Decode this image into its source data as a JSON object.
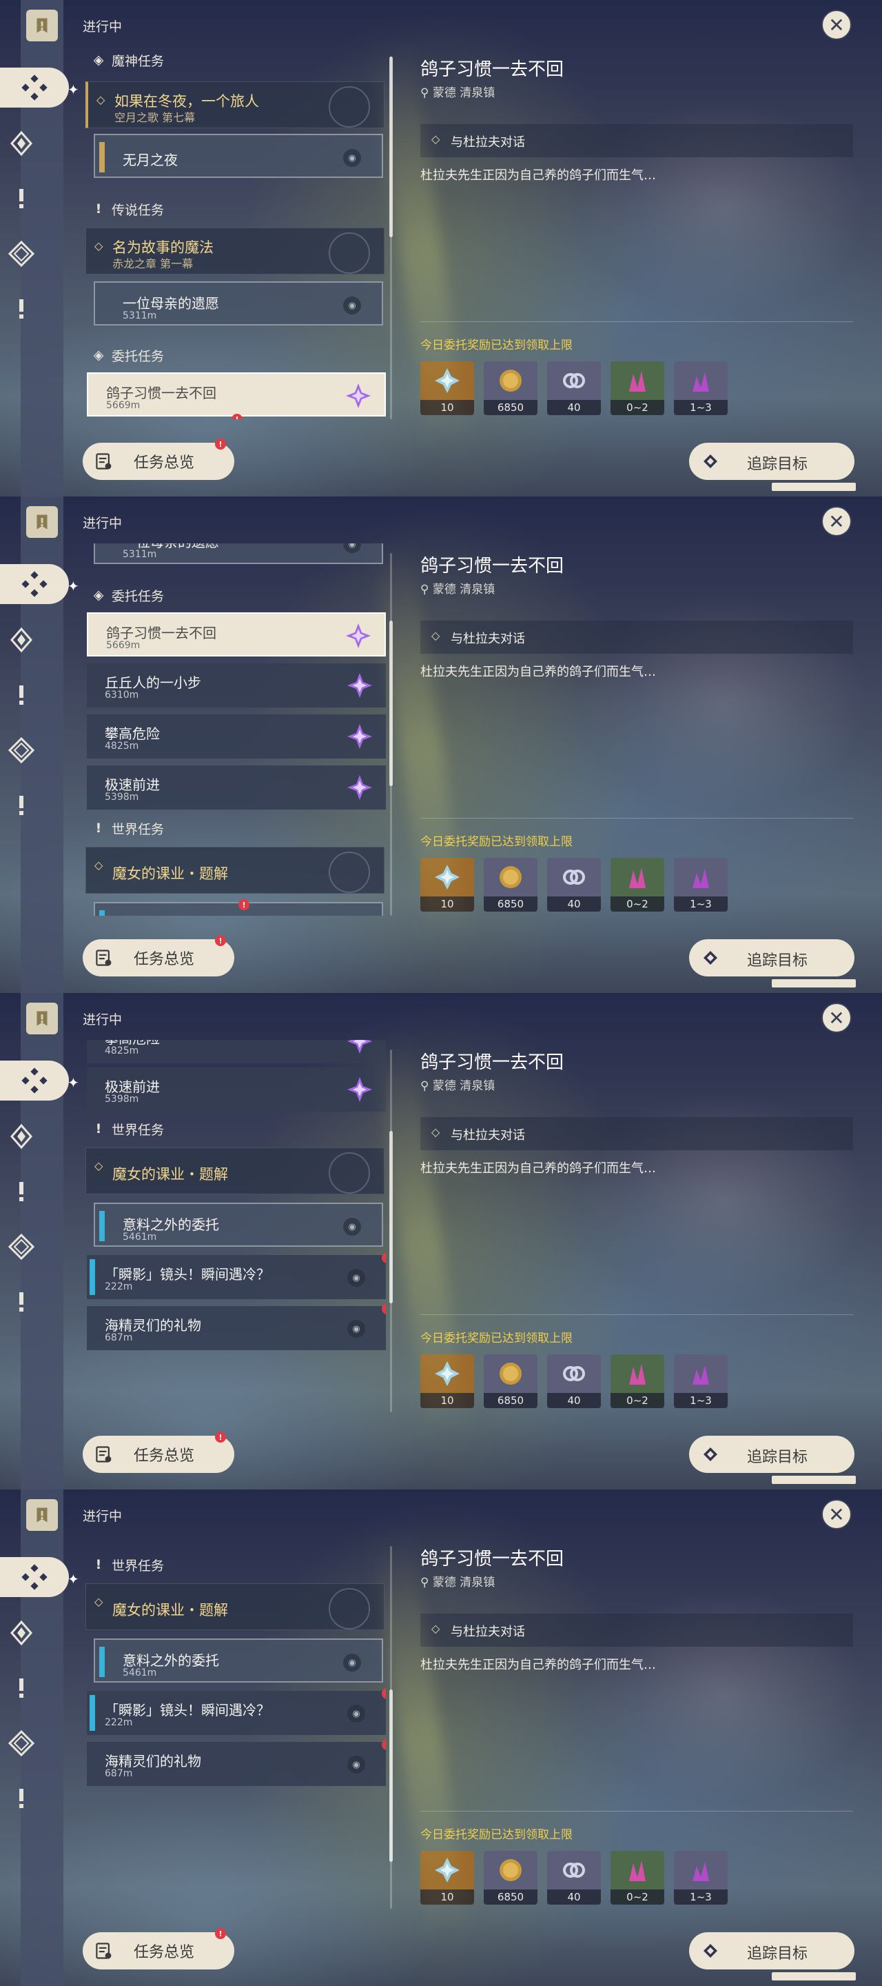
{
  "nav": {
    "in_progress": "进行中",
    "overview_label": "任务总览",
    "close_label": "✕"
  },
  "categories": {
    "archon": "魔神任务",
    "story": "传说任务",
    "commission": "委托任务",
    "world": "世界任务"
  },
  "quests": {
    "winter_title": "如果在冬夜，一个旅人",
    "winter_sub": "空月之歌 第七幕",
    "moonless": "无月之夜",
    "magic_title": "名为故事的魔法",
    "magic_sub": "赤龙之章 第一幕",
    "mother": "一位母亲的遗愿",
    "mother_dist": "5311m",
    "pigeon": "鸽子习惯一去不回",
    "pigeon_dist": "5669m",
    "hilichurl": "丘丘人的一小步",
    "hilichurl_dist": "6310m",
    "climb": "攀高危险",
    "climb_dist": "4825m",
    "speed": "极速前进",
    "speed_dist": "5398m",
    "witch": "魔女的课业・题解",
    "unexpected": "意料之外的委托",
    "unexpected_dist": "5461m",
    "flash": "「瞬影」镜头！瞬间遇冷？",
    "flash_dist": "222m",
    "spirit": "海精灵们的礼物",
    "spirit_dist": "687m"
  },
  "detail": {
    "title": "鸽子习惯一去不回",
    "location": "蒙德 清泉镇",
    "objective": "与杜拉夫对话",
    "description": "杜拉夫先生正因为自己养的鸽子们而生气…",
    "reward_note": "今日委托奖励已达到领取上限",
    "rewards": [
      {
        "icon": "primogem-icon",
        "count": "10",
        "color": "#9c6a2c"
      },
      {
        "icon": "mora-icon",
        "count": "6850",
        "color": "#5d5f7a"
      },
      {
        "icon": "companionship-icon",
        "count": "40",
        "color": "#5d5f7a"
      },
      {
        "icon": "mineral-icon",
        "count": "0~2",
        "color": "#4f6a4a"
      },
      {
        "icon": "crystal-icon",
        "count": "1~3",
        "color": "#5d5f7a"
      }
    ],
    "track_label": "追踪目标"
  }
}
